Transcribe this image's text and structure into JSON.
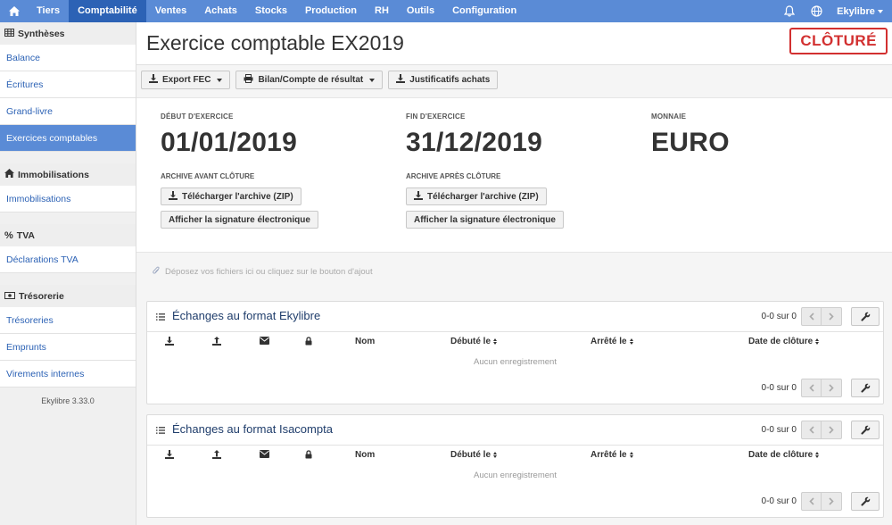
{
  "nav": {
    "items": [
      "Tiers",
      "Comptabilité",
      "Ventes",
      "Achats",
      "Stocks",
      "Production",
      "RH",
      "Outils",
      "Configuration"
    ],
    "active": "Comptabilité",
    "user": "Ekylibre"
  },
  "sidebar": {
    "groups": [
      {
        "title": "Synthèses",
        "icon": "table-icon",
        "items": [
          "Balance",
          "Écritures",
          "Grand-livre",
          "Exercices comptables"
        ]
      },
      {
        "title": "Immobilisations",
        "icon": "home-icon",
        "items": [
          "Immobilisations"
        ]
      },
      {
        "title": "TVA",
        "icon": "percent-icon",
        "items": [
          "Déclarations TVA"
        ]
      },
      {
        "title": "Trésorerie",
        "icon": "money-icon",
        "items": [
          "Trésoreries",
          "Emprunts",
          "Virements internes"
        ]
      }
    ],
    "active_item": "Exercices comptables",
    "version": "Ekylibre 3.33.0"
  },
  "page": {
    "title": "Exercice comptable EX2019",
    "status": "CLÔTURÉ"
  },
  "toolbar": {
    "export_fec": "Export FEC",
    "bilan": "Bilan/Compte de résultat",
    "justificatifs": "Justificatifs achats"
  },
  "info": {
    "start_label": "DÉBUT D'EXERCICE",
    "start_value": "01/01/2019",
    "end_label": "FIN D'EXERCICE",
    "end_value": "31/12/2019",
    "currency_label": "MONNAIE",
    "currency_value": "EURO",
    "archive_before_label": "ARCHIVE AVANT CLÔTURE",
    "archive_after_label": "ARCHIVE APRÈS CLÔTURE",
    "download_zip": "Télécharger l'archive (ZIP)",
    "show_signature": "Afficher la signature électronique"
  },
  "dropzone": "Déposez vos fichiers ici ou cliquez sur le bouton d'ajout",
  "panels": [
    {
      "title": "Échanges au format Ekylibre",
      "count": "0-0 sur 0",
      "columns": {
        "nom": "Nom",
        "debut": "Débuté le",
        "arrete": "Arrêté le",
        "cloture": "Date de clôture"
      },
      "empty": "Aucun enregistrement"
    },
    {
      "title": "Échanges au format Isacompta",
      "count": "0-0 sur 0",
      "columns": {
        "nom": "Nom",
        "debut": "Débuté le",
        "arrete": "Arrêté le",
        "cloture": "Date de clôture"
      },
      "empty": "Aucun enregistrement"
    }
  ]
}
